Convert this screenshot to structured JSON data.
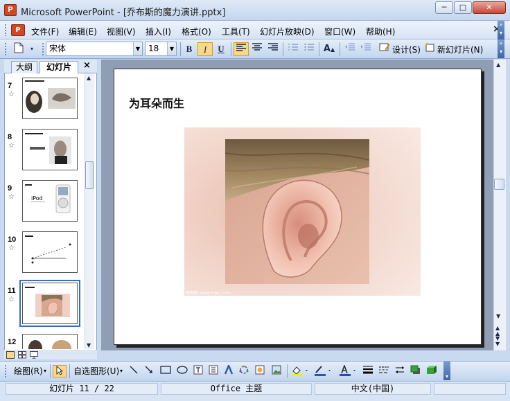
{
  "window": {
    "title": "Microsoft PowerPoint - [乔布斯的魔力演讲.pptx]",
    "app_icon": "powerpoint-icon",
    "minimize": "─",
    "maximize": "□",
    "close": "✕"
  },
  "menu": {
    "items": [
      "文件(F)",
      "编辑(E)",
      "视图(V)",
      "插入(I)",
      "格式(O)",
      "工具(T)",
      "幻灯片放映(D)",
      "窗口(W)",
      "帮助(H)"
    ],
    "close_doc": "×"
  },
  "toolbar": {
    "font_name": "宋体",
    "font_size": "18",
    "bold": "B",
    "italic": "I",
    "underline": "U",
    "design_label": "设计(S)",
    "new_slide_label": "新幻灯片(N)",
    "grow_font_glyph": "A"
  },
  "left_panel": {
    "tabs": [
      "大纲",
      "幻灯片"
    ],
    "close": "×",
    "slides": [
      {
        "number": "7",
        "has_star": true
      },
      {
        "number": "8",
        "has_star": true
      },
      {
        "number": "9",
        "has_star": true,
        "text": "iPod"
      },
      {
        "number": "10",
        "has_star": true
      },
      {
        "number": "11",
        "has_star": true,
        "selected": true
      },
      {
        "number": "12",
        "has_star": false
      }
    ],
    "star_glyph": "☆"
  },
  "slide": {
    "title": "为耳朵而生",
    "watermark": "昵图网 www.nipic.com"
  },
  "drawing_toolbar": {
    "draw_label": "绘图(R)",
    "autoshapes_label": "自选图形(U)"
  },
  "status": {
    "slide_counter": "幻灯片 11 / 22",
    "theme": "Office 主题",
    "language": "中文(中国)"
  },
  "colors": {
    "selection_highlight": "#fbd78a",
    "selected_thumb_border": "#3a6bc2",
    "slide_area_bg": "#8f9db5"
  }
}
